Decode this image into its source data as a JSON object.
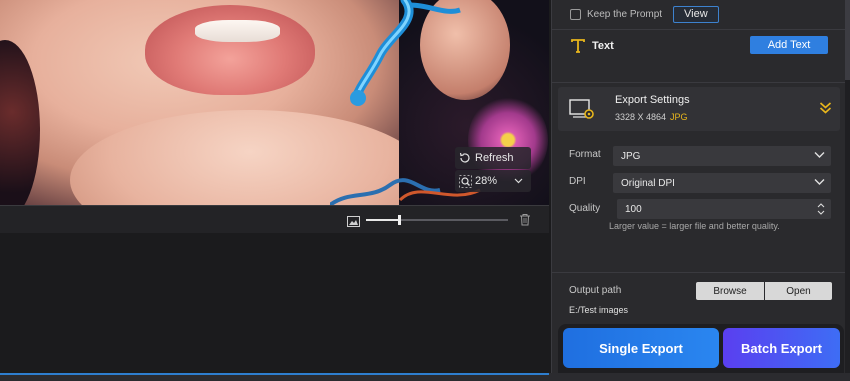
{
  "preview": {
    "refresh_label": "Refresh",
    "zoom_level": "28%",
    "slider_fraction": 0.23
  },
  "panel": {
    "keep_prompt_label": "Keep the Prompt",
    "keep_prompt_checked": false,
    "view_label": "View",
    "text_section_label": "Text",
    "add_text_label": "Add Text",
    "export": {
      "title": "Export Settings",
      "dimensions": "3328 X 4864",
      "format_badge": "JPG",
      "accent_color": "#e8b61c"
    },
    "format": {
      "label": "Format",
      "value": "JPG"
    },
    "dpi": {
      "label": "DPI",
      "value": "Original DPI"
    },
    "quality": {
      "label": "Quality",
      "value": "100",
      "hint": "Larger value = larger file and better quality."
    },
    "output": {
      "label": "Output path",
      "browse_label": "Browse",
      "open_label": "Open",
      "path": "E:/Test images"
    },
    "single_export_label": "Single Export",
    "batch_export_label": "Batch Export"
  },
  "icons": {
    "refresh": "refresh-icon",
    "zoom": "zoom-icon",
    "image": "image-icon",
    "trash": "trash-icon",
    "text": "text-icon",
    "export_settings": "export-settings-icon",
    "collapse": "double-chevron-icon"
  },
  "colors": {
    "primary_blue": "#2f7fe0",
    "batch_purple": "#5a3ff0",
    "panel_bg": "#2a2a2d"
  }
}
